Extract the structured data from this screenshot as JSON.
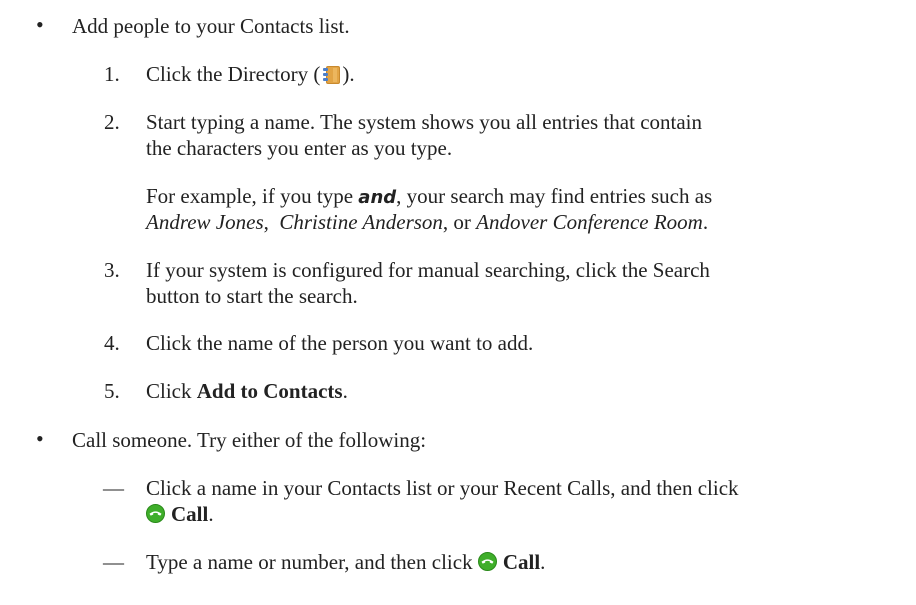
{
  "bullets": {
    "b1": "Add people to your Contacts list.",
    "b2": "Call someone. Try either of the following:"
  },
  "steps": [
    {
      "num": "1.",
      "text_a": "Click the Directory (",
      "text_b": ")."
    },
    {
      "num": "2.",
      "line1": "Start typing a name. The system shows you all entries that contain",
      "line2": "the characters you enter as you type."
    },
    {
      "num": "3.",
      "line1": "If your system is configured for manual searching, click the Search",
      "line2": "button to start the search."
    },
    {
      "num": "4.",
      "text": "Click the name of the person you want to add."
    },
    {
      "num": "5.",
      "text_a": "Click ",
      "bold": "Add to Contacts",
      "text_b": "."
    }
  ],
  "example": {
    "p1": "For example, if you type ",
    "term": "and",
    "p2": ", your search may find entries such as",
    "e1": "Andrew Jones",
    "sep1": ",  ",
    "e2": "Christine Anderson",
    "sep2": ", or ",
    "e3": "Andover Conference Room",
    "end": "."
  },
  "dashes": [
    {
      "mark": "—",
      "line1": "Click a name in your Contacts list or your Recent Calls, and then click",
      "bold": "Call",
      "end": "."
    },
    {
      "mark": "—",
      "text": "Type a name or number, and then click ",
      "bold": "Call",
      "end": "."
    }
  ],
  "icons": {
    "directory": "directory-book-icon",
    "call": "green-phone-call-icon",
    "call_color": "#3fae2a"
  }
}
